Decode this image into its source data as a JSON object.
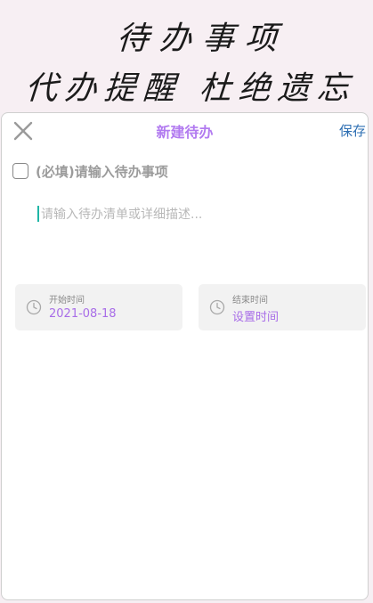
{
  "banner": {
    "line1": "待办事项",
    "line2": "代办提醒 杜绝遗忘"
  },
  "header": {
    "title": "新建待办",
    "save_label": "保存",
    "close_icon": "close-icon"
  },
  "form": {
    "required_label": "(必填)请输入待办事项",
    "required_checked": false,
    "description_placeholder": "请输入待办清单或详细描述..."
  },
  "times": {
    "start": {
      "label": "开始时间",
      "value": "2021-08-18",
      "icon": "clock-icon"
    },
    "end": {
      "label": "结束时间",
      "value": "设置时间",
      "icon": "clock-icon"
    }
  },
  "colors": {
    "accent": "#b27bf0",
    "save": "#2e6fb3",
    "time_value": "#a86de8",
    "cursor": "#20b6a6"
  }
}
